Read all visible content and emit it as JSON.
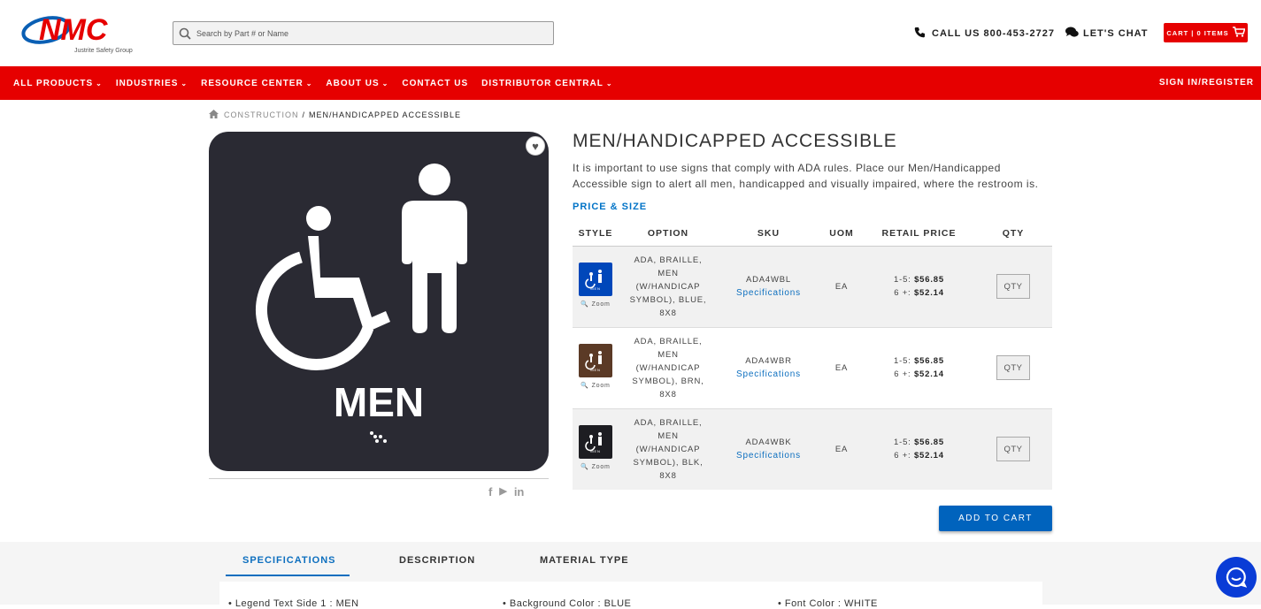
{
  "header": {
    "search_placeholder": "Search by Part # or Name",
    "call_label": "CALL US 800-453-2727",
    "chat_label": "LET'S CHAT",
    "cart_label": "CART | 0 ITEMS",
    "logo_text": "NMC",
    "logo_subtext": "Justrite Safety Group"
  },
  "nav": {
    "items": [
      "ALL PRODUCTS",
      "INDUSTRIES",
      "RESOURCE CENTER",
      "ABOUT US",
      "CONTACT US",
      "DISTRIBUTOR CENTRAL"
    ],
    "signin": "SIGN IN/REGISTER"
  },
  "breadcrumb": {
    "parent": "CONSTRUCTION",
    "separator": "/",
    "current": "MEN/HANDICAPPED ACCESSIBLE"
  },
  "product": {
    "title": "MEN/HANDICAPPED ACCESSIBLE",
    "description": "It is important to use signs that comply with ADA rules. Place our Men/Handicapped Accessible sign to alert all men, handicapped and visually impaired, where the restroom is.",
    "image_text": "MEN",
    "price_size_heading": "PRICE & SIZE"
  },
  "table": {
    "headers": [
      "STYLE",
      "OPTION",
      "SKU",
      "UOM",
      "RETAIL PRICE",
      "QTY"
    ],
    "rows": [
      {
        "option": "ADA, BRAILLE, MEN (W/HANDICAP SYMBOL), BLUE, 8X8",
        "sku": "ADA4WBL",
        "spec": "Specifications",
        "uom": "EA",
        "p1_label": "1-5:",
        "p1": "$56.85",
        "p2_label": "6 +:",
        "p2": "$52.14",
        "qty": "QTY",
        "zoom": "Zoom",
        "color": "#0047ba"
      },
      {
        "option": "ADA, BRAILLE, MEN (W/HANDICAP SYMBOL), BRN, 8X8",
        "sku": "ADA4WBR",
        "spec": "Specifications",
        "uom": "EA",
        "p1_label": "1-5:",
        "p1": "$56.85",
        "p2_label": "6 +:",
        "p2": "$52.14",
        "qty": "QTY",
        "zoom": "Zoom",
        "color": "#5b3a26"
      },
      {
        "option": "ADA, BRAILLE, MEN (W/HANDICAP SYMBOL), BLK, 8X8",
        "sku": "ADA4WBK",
        "spec": "Specifications",
        "uom": "EA",
        "p1_label": "1-5:",
        "p1": "$56.85",
        "p2_label": "6 +:",
        "p2": "$52.14",
        "qty": "QTY",
        "zoom": "Zoom",
        "color": "#1d1d22"
      }
    ]
  },
  "add_to_cart": "ADD TO CART",
  "tabs": [
    "SPECIFICATIONS",
    "DESCRIPTION",
    "MATERIAL TYPE"
  ],
  "specs": [
    "Legend Text Side 1 : MEN",
    "Background Color : BLUE",
    "Font Color : WHITE"
  ],
  "colors": {
    "brand_red": "#e60000",
    "link_blue": "#0d6fbf",
    "button_blue": "#0063bd"
  }
}
